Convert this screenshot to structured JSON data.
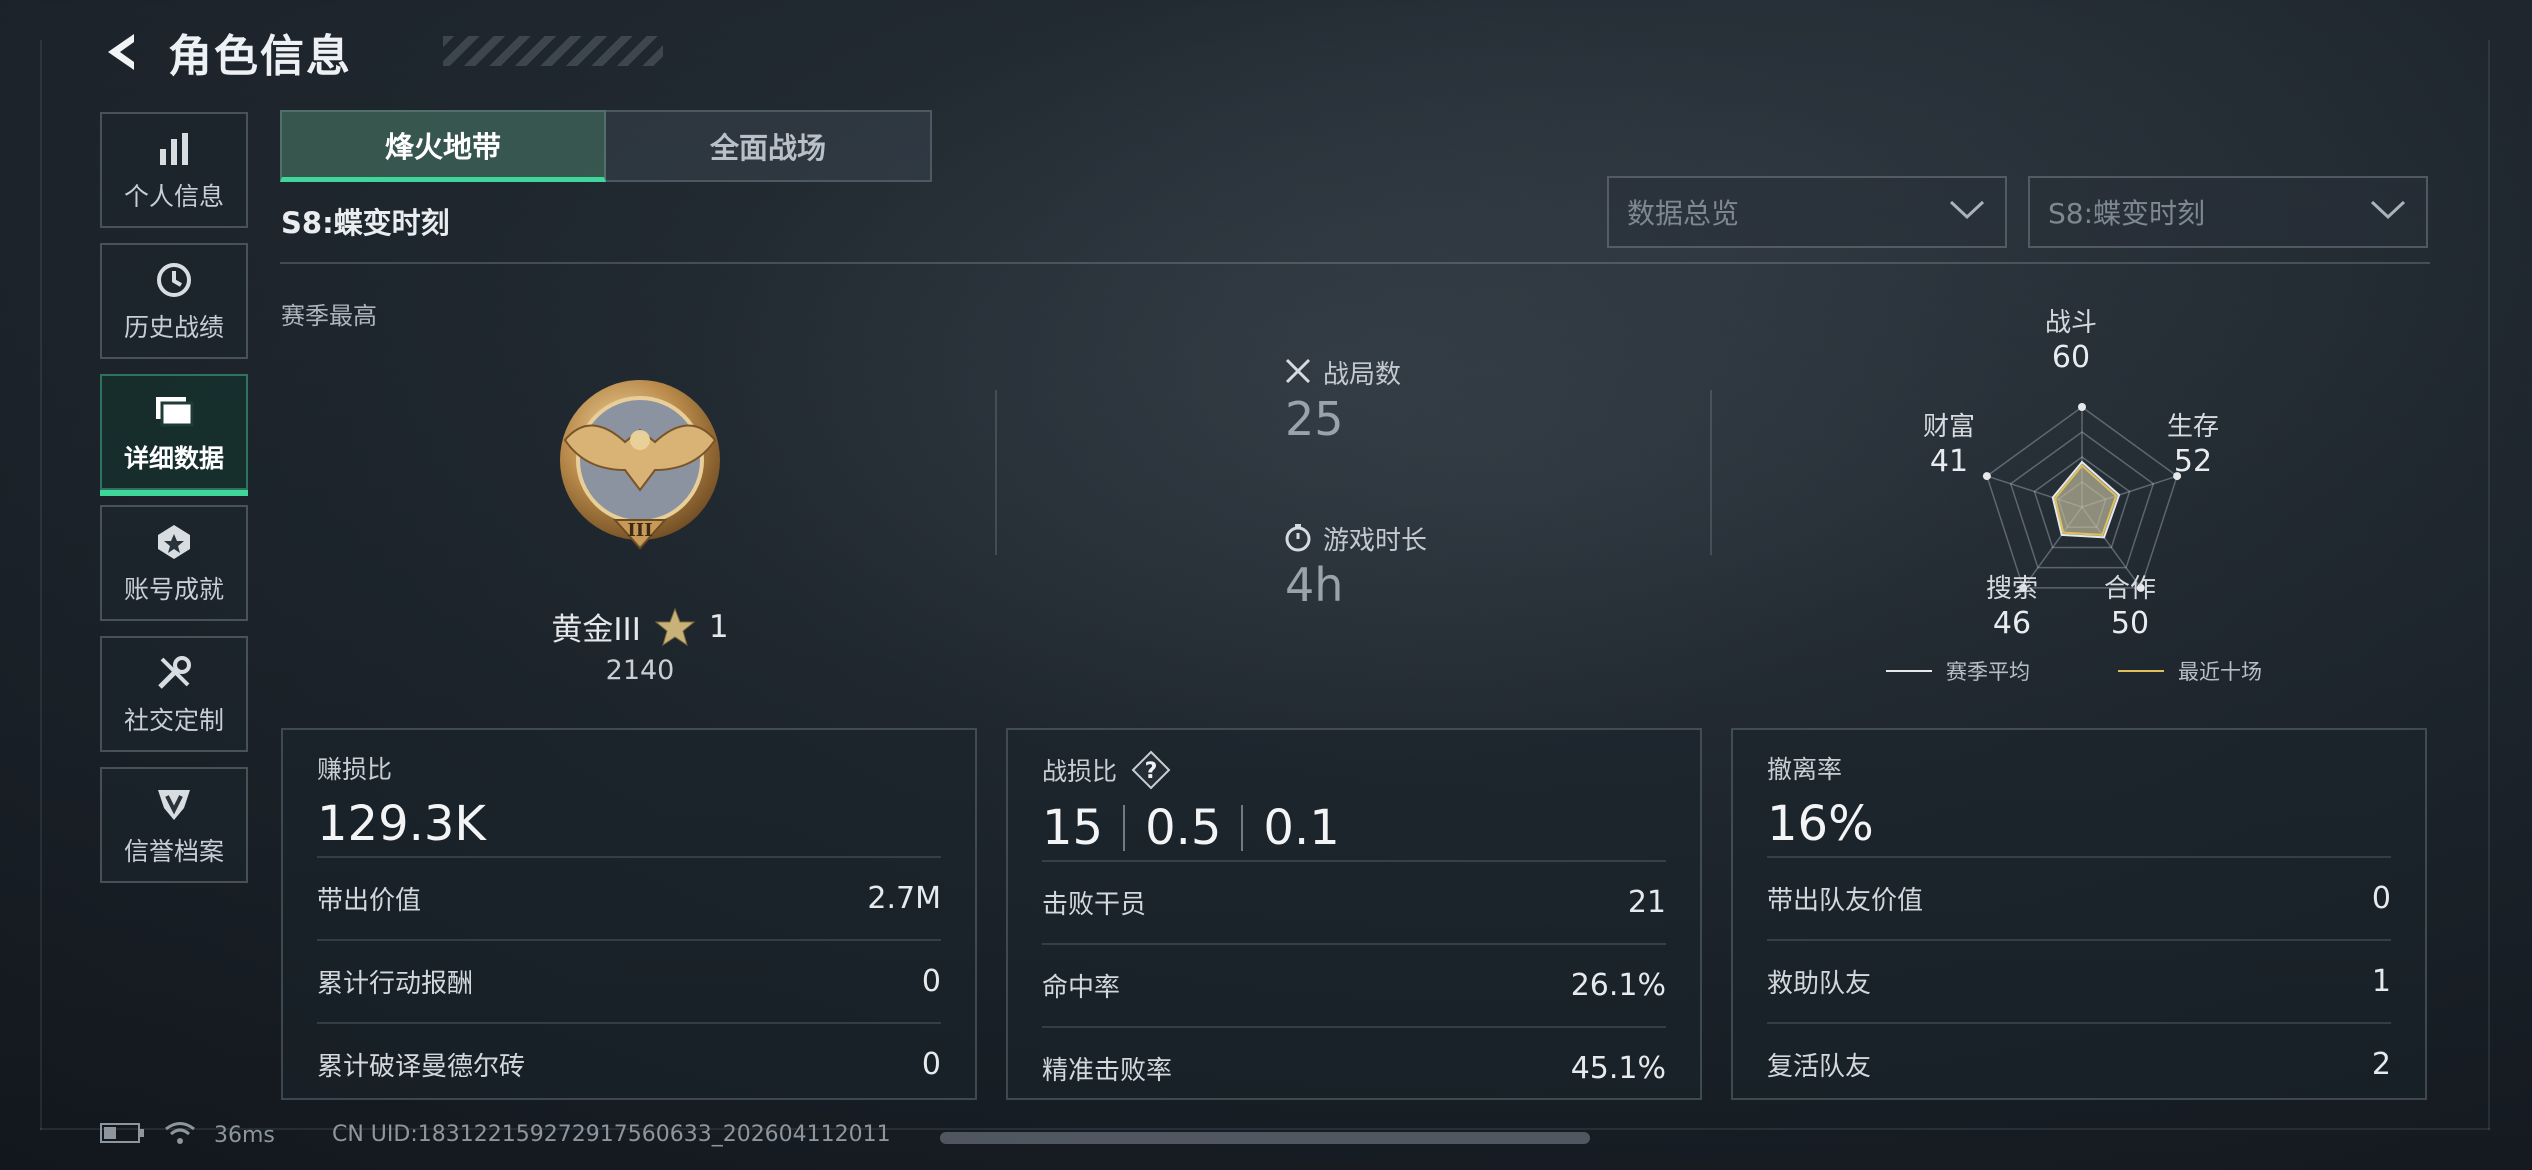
{
  "header": {
    "title": "角色信息"
  },
  "sidebar": {
    "items": [
      {
        "label": "个人信息",
        "icon": "bar-chart-icon",
        "active": false
      },
      {
        "label": "历史战绩",
        "icon": "history-clock-icon",
        "active": false
      },
      {
        "label": "详细数据",
        "icon": "folders-icon",
        "active": true
      },
      {
        "label": "账号成就",
        "icon": "medal-icon",
        "active": false
      },
      {
        "label": "社交定制",
        "icon": "tools-icon",
        "active": false
      },
      {
        "label": "信誉档案",
        "icon": "shield-badge-icon",
        "active": false
      }
    ]
  },
  "tabs": [
    {
      "label": "烽火地带",
      "active": true
    },
    {
      "label": "全面战场",
      "active": false
    }
  ],
  "season": {
    "title": "S8:蝶变时刻",
    "best_label": "赛季最高"
  },
  "filters": {
    "view": "数据总览",
    "season": "S8:蝶变时刻"
  },
  "rank": {
    "name": "黄金III",
    "badge_numeral": "III",
    "stars": "1",
    "score": "2140"
  },
  "match_stats": {
    "matches_label": "战局数",
    "matches_value": "25",
    "playtime_label": "游戏时长",
    "playtime_value": "4h"
  },
  "radar": {
    "axes": [
      {
        "label": "战斗",
        "value": "60"
      },
      {
        "label": "生存",
        "value": "52"
      },
      {
        "label": "合作",
        "value": "50"
      },
      {
        "label": "搜索",
        "value": "46"
      },
      {
        "label": "财富",
        "value": "41"
      }
    ],
    "legend": [
      {
        "label": "赛季平均",
        "color": "#e6e9ec"
      },
      {
        "label": "最近十场",
        "color": "#e0c05a"
      }
    ]
  },
  "cards": {
    "profit": {
      "title": "赚损比",
      "big": "129.3K",
      "rows": [
        {
          "label": "带出价值",
          "value": "2.7M"
        },
        {
          "label": "累计行动报酬",
          "value": "0"
        },
        {
          "label": "累计破译曼德尔砖",
          "value": "0"
        }
      ]
    },
    "combat": {
      "title": "战损比",
      "help": "?",
      "big": [
        "15",
        "0.5",
        "0.1"
      ],
      "rows": [
        {
          "label": "击败干员",
          "value": "21"
        },
        {
          "label": "命中率",
          "value": "26.1%"
        },
        {
          "label": "精准击败率",
          "value": "45.1%"
        }
      ]
    },
    "extract": {
      "title": "撤离率",
      "big": "16%",
      "rows": [
        {
          "label": "带出队友价值",
          "value": "0"
        },
        {
          "label": "救助队友",
          "value": "1"
        },
        {
          "label": "复活队友",
          "value": "2"
        }
      ]
    }
  },
  "footer": {
    "ping": "36ms",
    "uid": "CN UID:18312215927291756063​3_202604112011"
  },
  "colors": {
    "accent": "#3fd69a",
    "gold": "#e0c05a"
  }
}
